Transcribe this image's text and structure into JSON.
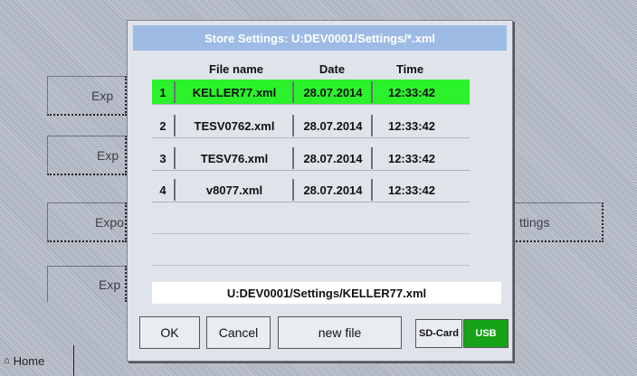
{
  "background": {
    "buttons": [
      "Exp",
      "Exp",
      "Expo",
      "ttings",
      "Exp"
    ],
    "home_label": "Home"
  },
  "dialog": {
    "title": "Store Settings:  U:DEV0001/Settings/*.xml",
    "columns": [
      "File name",
      "Date",
      "Time"
    ],
    "files": [
      {
        "index": "1",
        "name": "KELLER77.xml",
        "date": "28.07.2014",
        "time": "12:33:42",
        "selected": true
      },
      {
        "index": "2",
        "name": "TESV0762.xml",
        "date": "28.07.2014",
        "time": "12:33:42",
        "selected": false
      },
      {
        "index": "3",
        "name": "TESV76.xml",
        "date": "28.07.2014",
        "time": "12:33:42",
        "selected": false
      },
      {
        "index": "4",
        "name": "v8077.xml",
        "date": "28.07.2014",
        "time": "12:33:42",
        "selected": false
      }
    ],
    "selected_path": "U:DEV0001/Settings/KELLER77.xml",
    "buttons": {
      "ok": "OK",
      "cancel": "Cancel",
      "new_file": "new file",
      "sd_card": "SD-Card",
      "usb": "USB"
    },
    "active_storage": "USB"
  },
  "colors": {
    "selected_row": "#2bf22b",
    "title_bar": "#9dbbe4",
    "usb_active": "#17a317"
  }
}
